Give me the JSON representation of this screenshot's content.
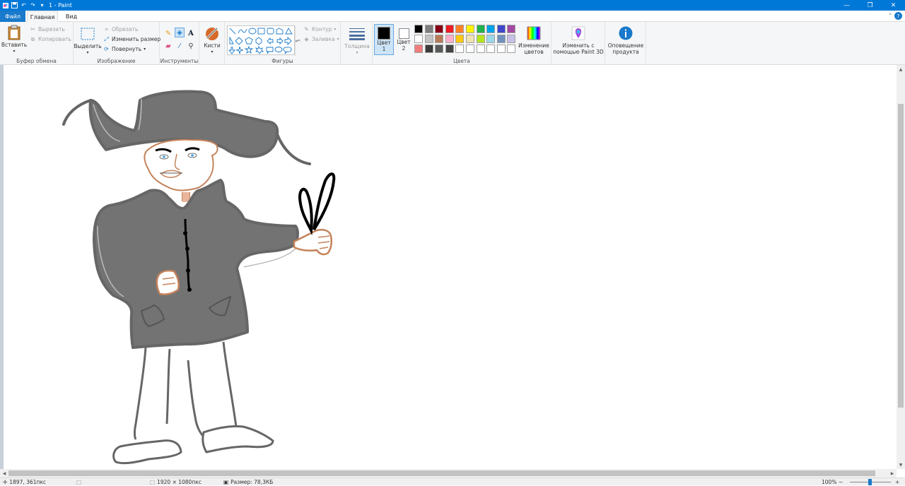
{
  "window": {
    "title": "1 - Paint",
    "min": "—",
    "restore": "❐",
    "close": "✕"
  },
  "tabs": {
    "file": "Файл",
    "home": "Главная",
    "view": "Вид"
  },
  "clipboard": {
    "paste": "Вставить",
    "cut": "Вырезать",
    "copy": "Копировать",
    "label": "Буфер обмена"
  },
  "image": {
    "select": "Выделить",
    "crop": "Обрезать",
    "resize": "Изменить размер",
    "rotate": "Повернуть",
    "label": "Изображение"
  },
  "tools": {
    "label": "Инструменты"
  },
  "brushes": {
    "label": "Кисти"
  },
  "shapes": {
    "outline": "Контур",
    "fill": "Заливка",
    "label": "Фигуры"
  },
  "size": {
    "label": "Толщина"
  },
  "colors": {
    "color1_line1": "Цвет",
    "color1_line2": "1",
    "color2_line1": "Цвет",
    "color2_line2": "2",
    "edit_line1": "Изменение",
    "edit_line2": "цветов",
    "label": "Цвета",
    "color1": "#000000",
    "color2": "#ffffff",
    "palette_row1": [
      "#000000",
      "#7f7f7f",
      "#880015",
      "#ed1c24",
      "#ff7f27",
      "#fff200",
      "#22b14c",
      "#00a2e8",
      "#3f48cc",
      "#a349a4"
    ],
    "palette_row2": [
      "#ffffff",
      "#c3c3c3",
      "#b97a57",
      "#ffaec9",
      "#ffc90e",
      "#efe4b0",
      "#b5e61d",
      "#99d9ea",
      "#7092be",
      "#c8bfe7"
    ],
    "palette_row3": [
      "#f07c7c",
      "#3a3a3a",
      "#5a5a5a",
      "#444444",
      "#ffffff",
      "#ffffff",
      "#ffffff",
      "#ffffff",
      "#ffffff",
      "#ffffff"
    ]
  },
  "paint3d": {
    "line1": "Изменить с",
    "line2": "помощью Paint 3D"
  },
  "notify": {
    "line1": "Оповещение",
    "line2": "продукта"
  },
  "status": {
    "cursor": "1897, 361пкс",
    "dimensions": "1920 × 1080пкс",
    "filesize": "Размер: 78,3КБ",
    "zoom": "100%"
  }
}
